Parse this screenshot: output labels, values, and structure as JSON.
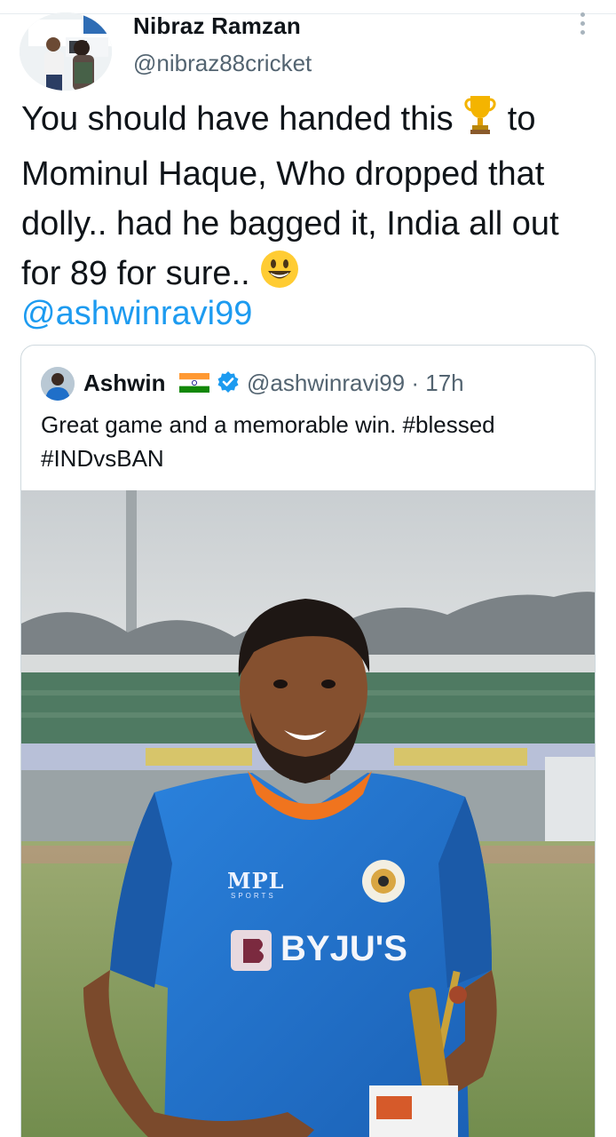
{
  "author": {
    "name": "Nibraz Ramzan",
    "handle": "@nibraz88cricket"
  },
  "tweet": {
    "text_before_trophy": "You should have handed this ",
    "trophy_emoji": "trophy-emoji",
    "text_after_trophy": " to Mominul Haque, Who dropped that dolly.. had he bagged it, India all out for 89 for sure.. ",
    "smile_emoji": "smiling-face-emoji",
    "mention": "@ashwinravi99"
  },
  "quoted_tweet": {
    "name": "Ashwin",
    "flag_icon": "india-flag-icon",
    "verified_icon": "verified-badge-icon",
    "handle_and_time": "@ashwinravi99 · 17h",
    "text": "Great game and a memorable win. #blessed #INDvsBAN",
    "jersey_sponsor": "BYJU'S",
    "jersey_brand": "MPL",
    "jersey_brand_sub": "SPORTS"
  },
  "colors": {
    "link": "#1d9bf0",
    "secondary_text": "#536471",
    "border": "#cfd9de",
    "jersey_blue": "#1f6fc9",
    "jersey_orange": "#f0741e"
  }
}
